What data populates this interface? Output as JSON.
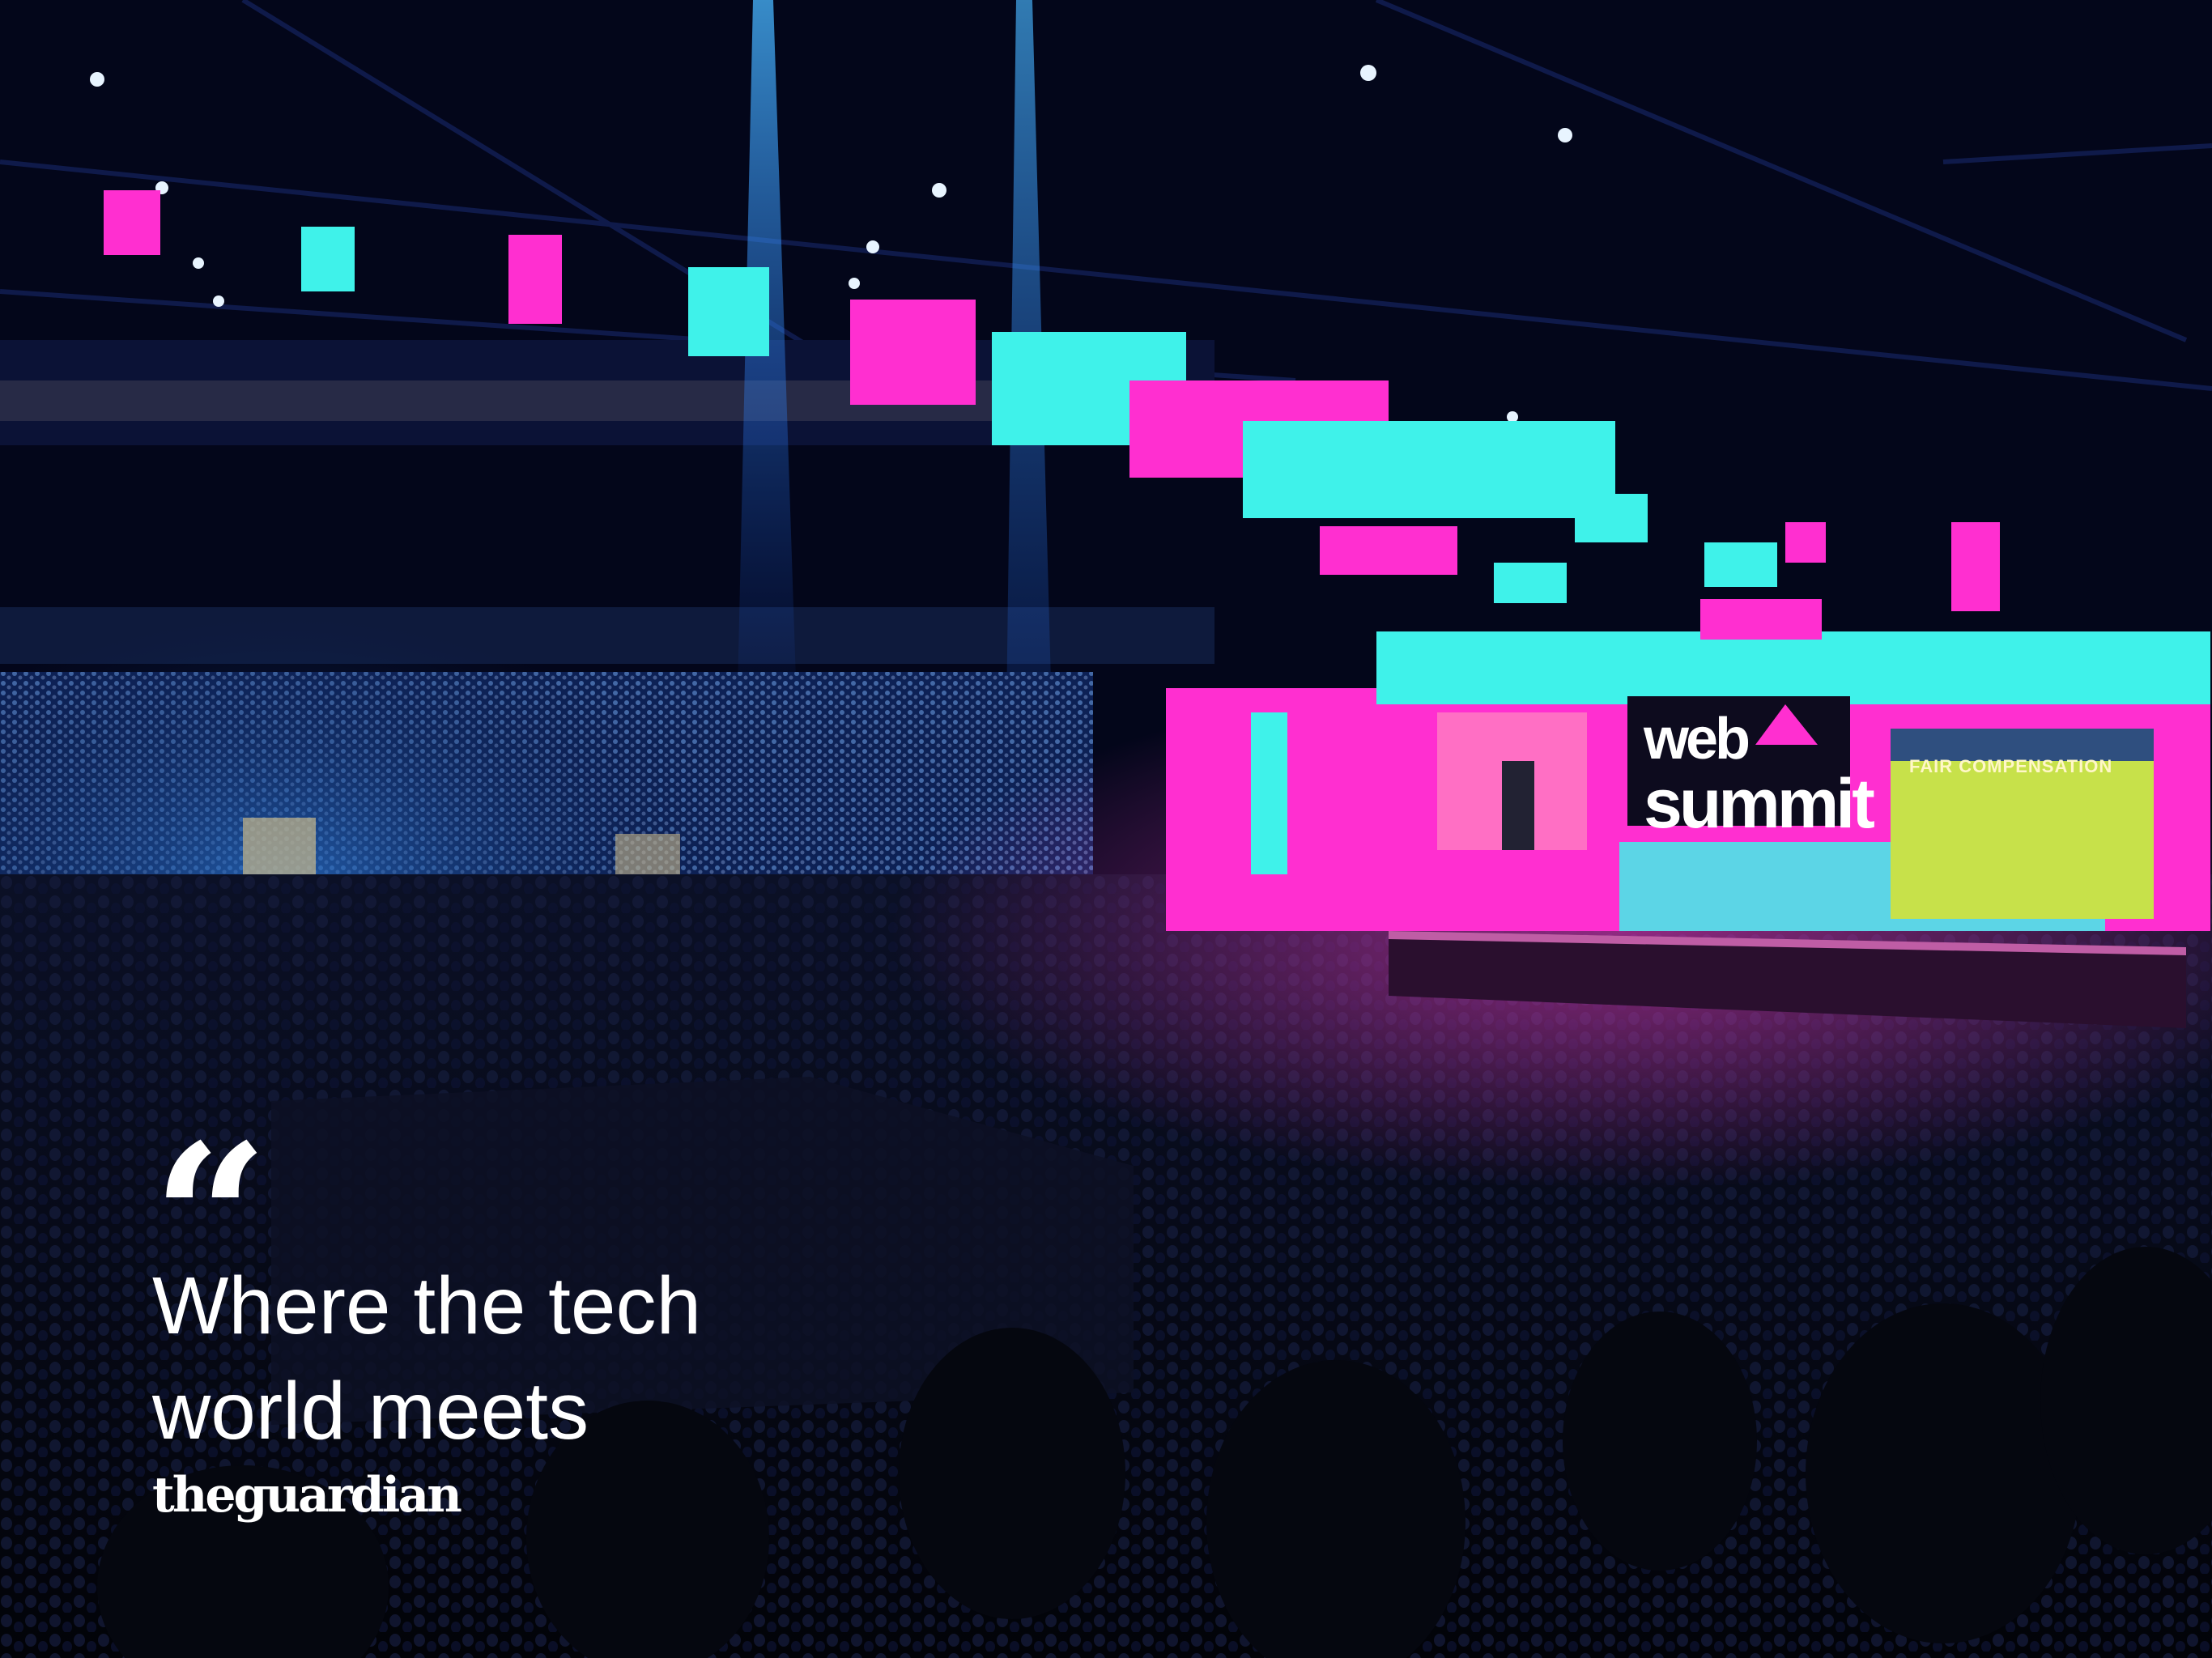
{
  "quote_mark": "“",
  "headline": {
    "line1": "Where the tech",
    "line2": "world meets"
  },
  "brand": "theguardian",
  "stage": {
    "logo_line1": "web",
    "logo_line2": "summit",
    "screen_title": "FAIR COMPENSATION"
  },
  "colors": {
    "background": "#03061a",
    "cyan": "#3ff2ea",
    "magenta": "#ff2fd0",
    "spotlight": "#1f8bff",
    "text": "#ffffff"
  }
}
